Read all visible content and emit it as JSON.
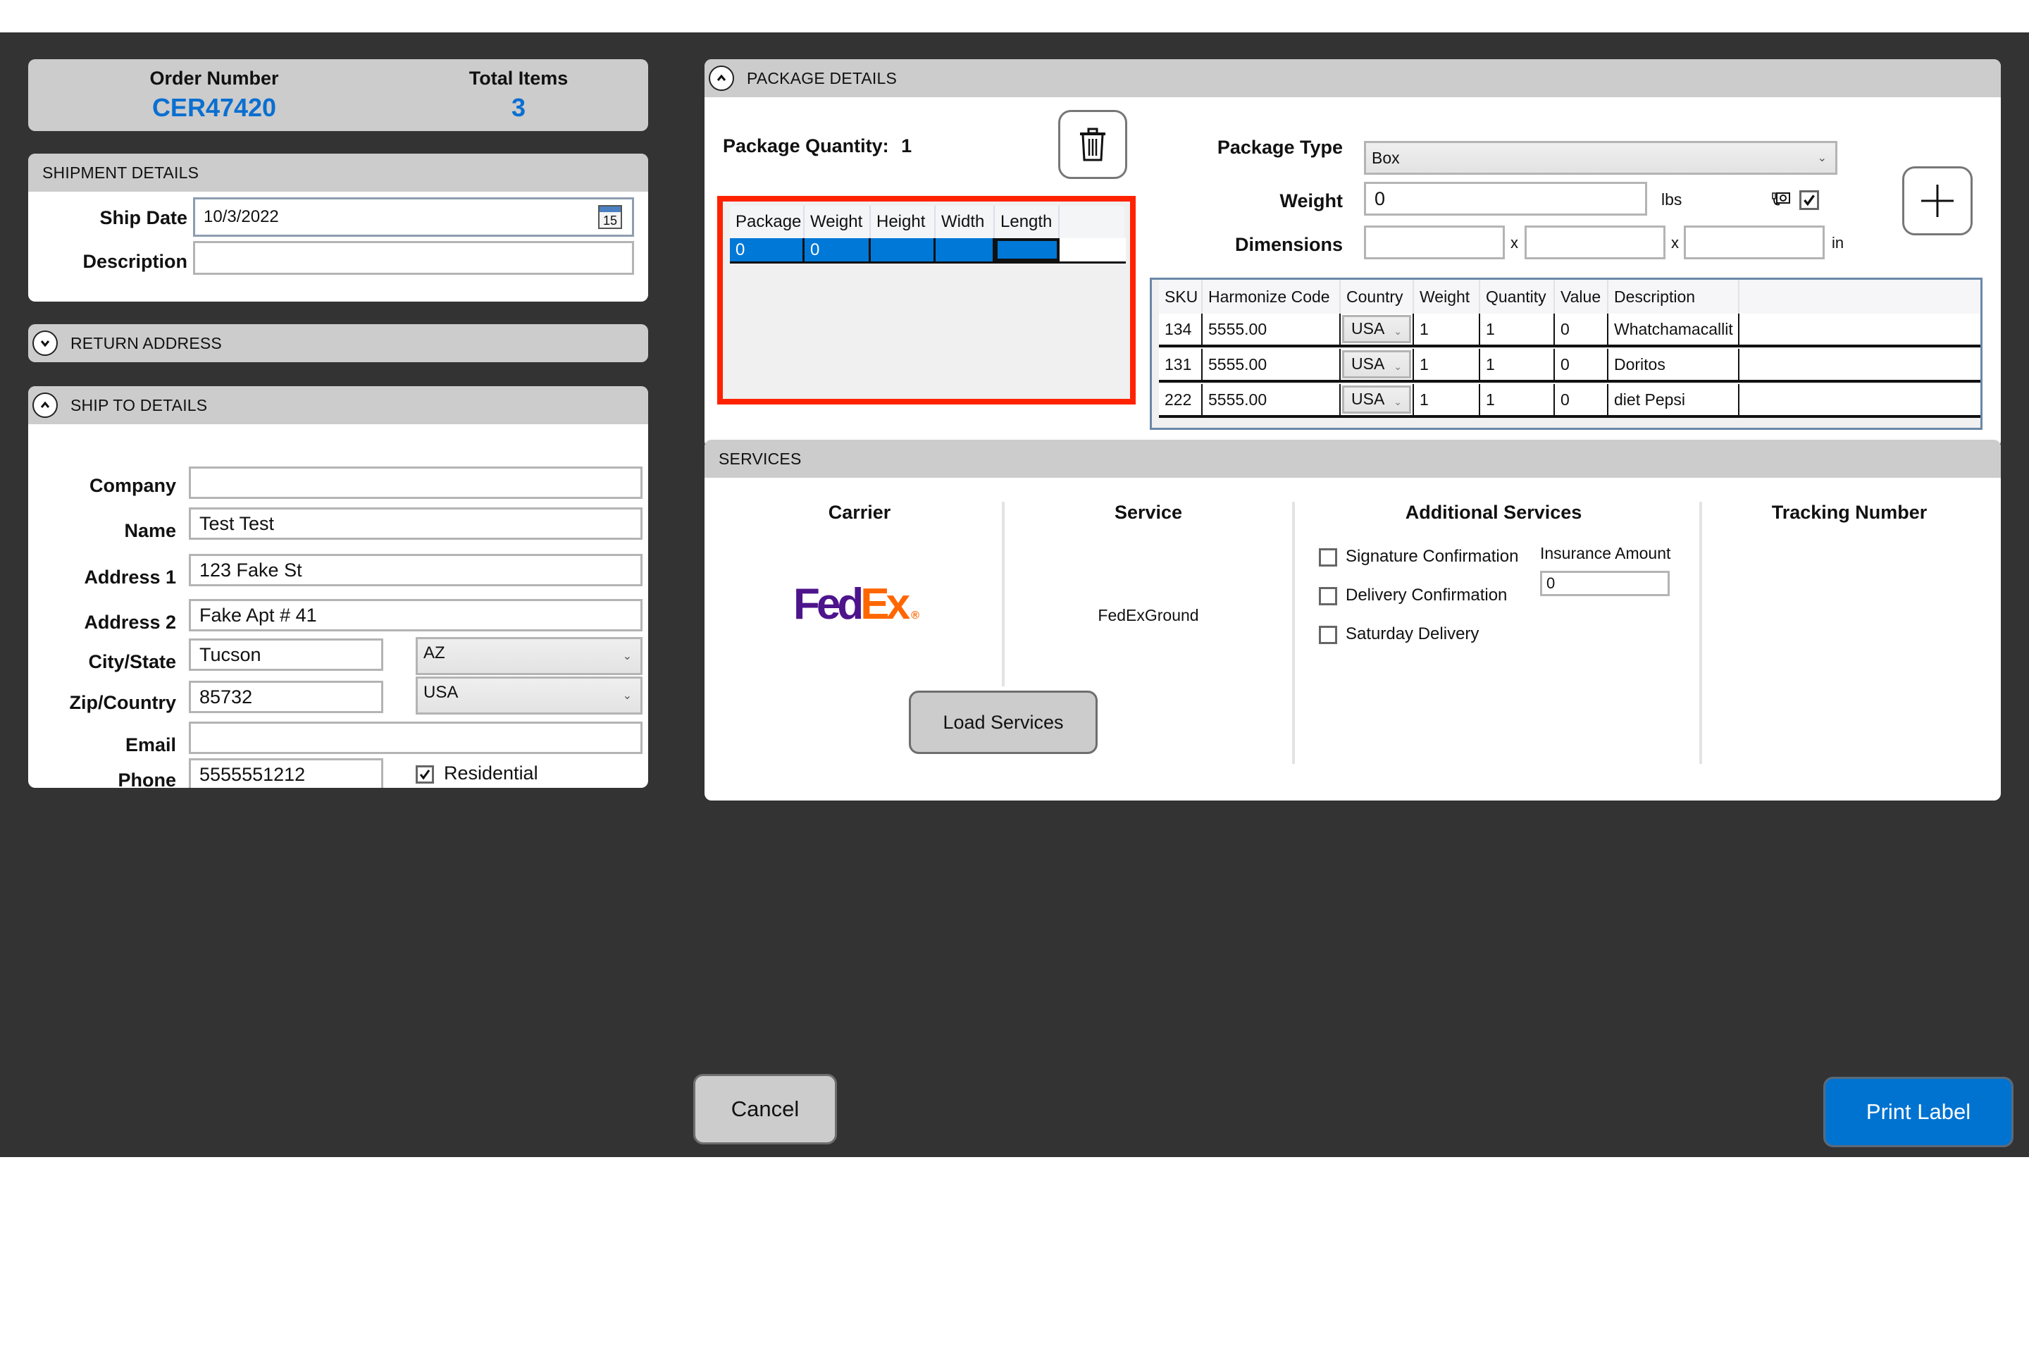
{
  "order_summary": {
    "order_number_label": "Order Number",
    "order_number": "CER47420",
    "total_items_label": "Total Items",
    "total_items": "3"
  },
  "shipment_details": {
    "title": "SHIPMENT DETAILS",
    "ship_date_label": "Ship Date",
    "ship_date": "10/3/2022",
    "calendar_day": "15",
    "description_label": "Description",
    "description": ""
  },
  "return_address": {
    "title": "RETURN ADDRESS",
    "expanded": false
  },
  "ship_to": {
    "title": "SHIP TO DETAILS",
    "expanded": true,
    "company_label": "Company",
    "company": "",
    "name_label": "Name",
    "name": "Test Test",
    "address1_label": "Address 1",
    "address1": "123 Fake St",
    "address2_label": "Address 2",
    "address2": "Fake Apt # 41",
    "city_state_label": "City/State",
    "city": "Tucson",
    "state": "AZ",
    "zip_country_label": "Zip/Country",
    "zip": "85732",
    "country": "USA",
    "email_label": "Email",
    "email": "",
    "phone_label": "Phone",
    "phone": "5555551212",
    "residential_label": "Residential",
    "residential": true
  },
  "package_details": {
    "title": "PACKAGE DETAILS",
    "expanded": true,
    "quantity_label": "Package Quantity:",
    "quantity": "1",
    "grid_columns": [
      "Package",
      "Weight",
      "Height",
      "Width",
      "Length"
    ],
    "grid_rows": [
      [
        "0",
        "0",
        "",
        "",
        ""
      ]
    ],
    "package_type_label": "Package Type",
    "package_type": "Box",
    "weight_label": "Weight",
    "weight": "0",
    "weight_unit": "lbs",
    "scale_enabled": true,
    "dimensions_label": "Dimensions",
    "dim1": "",
    "dim2": "",
    "dim3": "",
    "dim_sep": "x",
    "dim_unit": "in",
    "items_columns": [
      "SKU",
      "Harmonize Code",
      "Country",
      "Weight",
      "Quantity",
      "Value",
      "Description"
    ],
    "items": [
      {
        "sku": "134",
        "code": "5555.00",
        "country": "USA",
        "weight": "1",
        "quantity": "1",
        "value": "0",
        "description": "Whatchamacallit"
      },
      {
        "sku": "131",
        "code": "5555.00",
        "country": "USA",
        "weight": "1",
        "quantity": "1",
        "value": "0",
        "description": "Doritos"
      },
      {
        "sku": "222",
        "code": "5555.00",
        "country": "USA",
        "weight": "1",
        "quantity": "1",
        "value": "0",
        "description": "diet Pepsi"
      }
    ]
  },
  "services": {
    "title": "SERVICES",
    "carrier_label": "Carrier",
    "carrier_logo_fed": "Fed",
    "carrier_logo_ex": "Ex",
    "carrier_logo_reg": "®",
    "service_label": "Service",
    "service": "FedExGround",
    "additional_label": "Additional Services",
    "options": [
      {
        "label": "Signature Confirmation",
        "checked": false
      },
      {
        "label": "Delivery Confirmation",
        "checked": false
      },
      {
        "label": "Saturday Delivery",
        "checked": false
      }
    ],
    "insurance_label": "Insurance Amount",
    "insurance_amount": "0",
    "tracking_label": "Tracking Number",
    "tracking_number": "",
    "load_button": "Load Services"
  },
  "footer": {
    "cancel": "Cancel",
    "print": "Print Label"
  },
  "colors": {
    "accent": "#0073d1",
    "selection": "#0078d7",
    "highlight": "#ff2200",
    "background": "#333333",
    "fedex_purple": "#4d148c",
    "fedex_orange": "#ff6600"
  }
}
